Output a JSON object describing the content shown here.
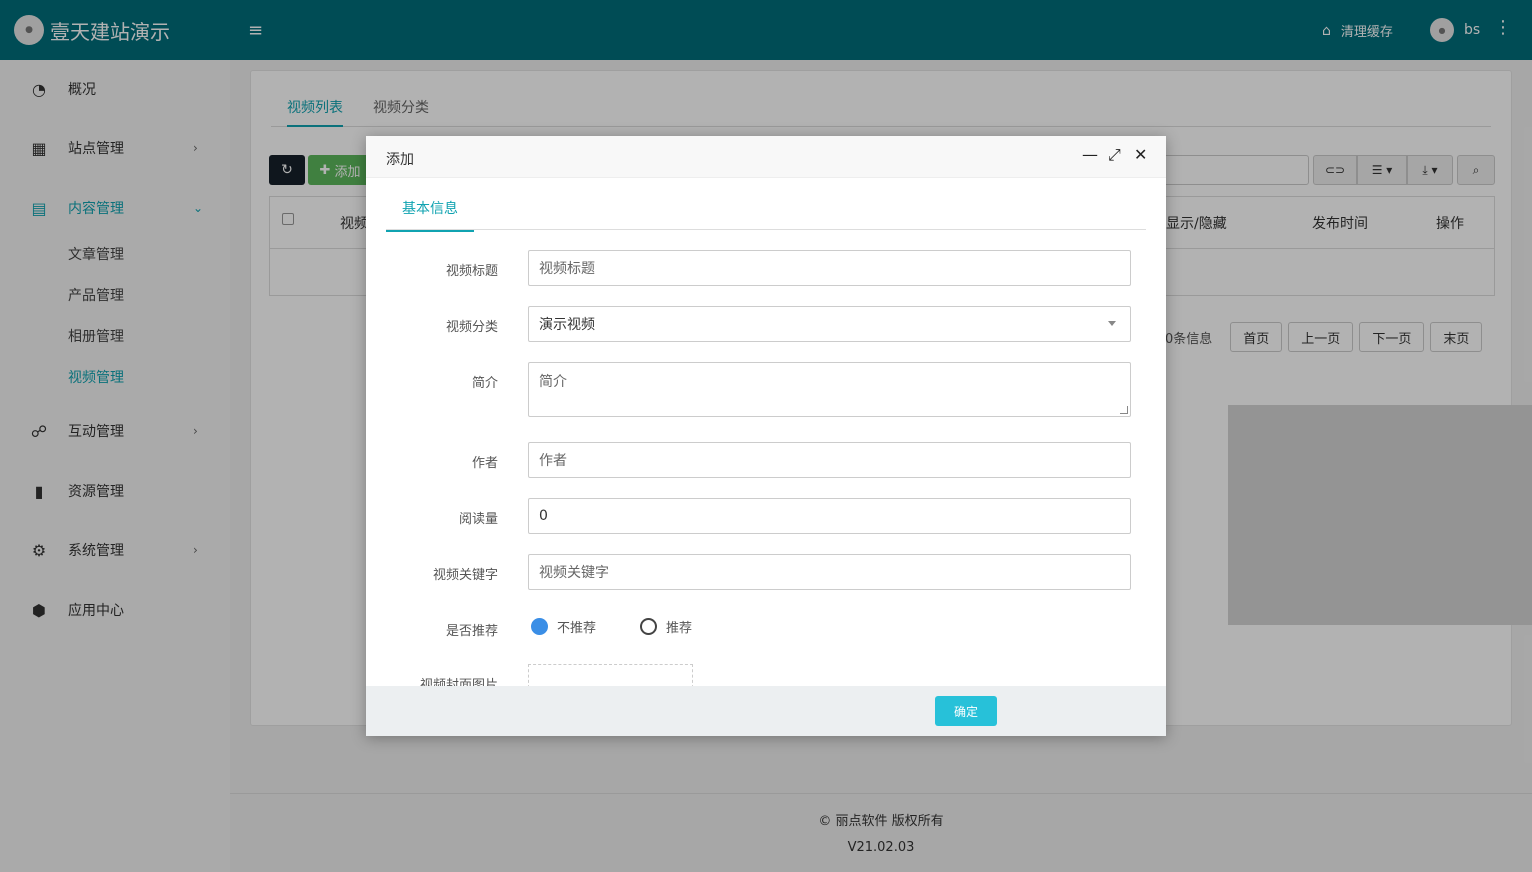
{
  "header": {
    "brand": "壹天建站演示",
    "clear_cache": "清理缓存",
    "username": "bs",
    "menu_icon": "hamburger-icon",
    "clear_icon": "broom-icon",
    "more_icon": "kebab-icon"
  },
  "sidebar": {
    "items": [
      {
        "label": "概况",
        "icon": "dashboard-icon"
      },
      {
        "label": "站点管理",
        "icon": "grid-icon"
      },
      {
        "label": "内容管理",
        "icon": "document-icon"
      },
      {
        "label": "互动管理",
        "icon": "handshake-icon"
      },
      {
        "label": "资源管理",
        "icon": "file-icon"
      },
      {
        "label": "系统管理",
        "icon": "gear-icon"
      },
      {
        "label": "应用中心",
        "icon": "cube-icon"
      }
    ],
    "content_sub": [
      "文章管理",
      "产品管理",
      "相册管理",
      "视频管理"
    ]
  },
  "main": {
    "tabs": [
      "视频列表",
      "视频分类"
    ],
    "add_label": "添加",
    "columns": {
      "title": "视频",
      "show_hide": "显示/隐藏",
      "publish_time": "发布时间",
      "actions": "操作"
    },
    "pager": {
      "info": "0条信息",
      "first": "首页",
      "prev": "上一页",
      "next": "下一页",
      "last": "末页"
    }
  },
  "footer": {
    "copyright": "© 丽点软件 版权所有",
    "version": "V21.02.03"
  },
  "modal": {
    "title": "添加",
    "tab": "基本信息",
    "fields": {
      "title_label": "视频标题",
      "title_placeholder": "视频标题",
      "category_label": "视频分类",
      "category_value": "演示视频",
      "intro_label": "简介",
      "intro_placeholder": "简介",
      "author_label": "作者",
      "author_placeholder": "作者",
      "views_label": "阅读量",
      "views_value": "0",
      "keywords_label": "视频关键字",
      "keywords_placeholder": "视频关键字",
      "recommend_label": "是否推荐",
      "recommend_no": "不推荐",
      "recommend_yes": "推荐",
      "cover_label": "视频封面图片"
    },
    "ok_label": "确定"
  },
  "colors": {
    "header": "#006d7a",
    "accent": "#10a3b1",
    "confirm": "#27c1d9",
    "radio_on": "#3a8ee6"
  }
}
